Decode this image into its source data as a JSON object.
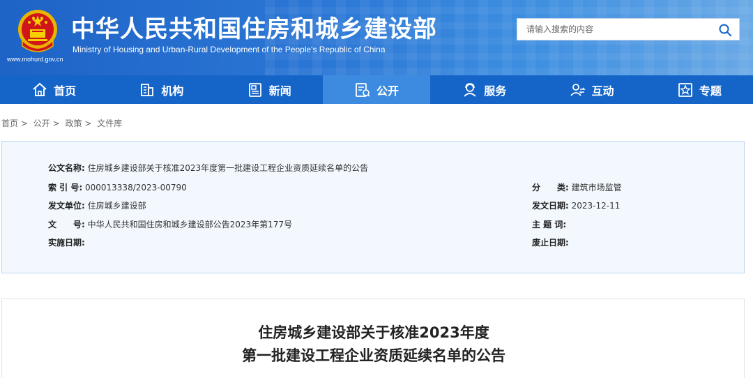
{
  "header": {
    "title_cn": "中华人民共和国住房和城乡建设部",
    "title_en": "Ministry of Housing and Urban-Rural Development of the People's Republic of China",
    "site_url": "www.mohurd.gov.cn",
    "emblem_icon": "national-emblem-icon",
    "search": {
      "placeholder": "请输入搜索的内容",
      "icon": "search-icon"
    }
  },
  "nav": {
    "items": [
      {
        "label": "首页",
        "icon": "home-icon"
      },
      {
        "label": "机构",
        "icon": "building-icon"
      },
      {
        "label": "新闻",
        "icon": "news-icon"
      },
      {
        "label": "公开",
        "icon": "disclosure-icon",
        "active": true
      },
      {
        "label": "服务",
        "icon": "service-icon"
      },
      {
        "label": "互动",
        "icon": "interaction-icon"
      },
      {
        "label": "专题",
        "icon": "topic-icon"
      }
    ]
  },
  "breadcrumb": {
    "items": [
      "首页",
      "公开",
      "政策",
      "文件库"
    ],
    "separator": ">"
  },
  "info": {
    "doc_name_label": "公文名称:",
    "doc_name": "住房城乡建设部关于核准2023年度第一批建设工程企业资质延续名单的公告",
    "index_label": "索 引 号:",
    "index": "000013338/2023-00790",
    "category_label": "分　　类:",
    "category": "建筑市场监管",
    "issuer_label": "发文单位:",
    "issuer": "住房城乡建设部",
    "issue_date_label": "发文日期:",
    "issue_date": "2023-12-11",
    "doc_no_label": "文　　号:",
    "doc_no": "中华人民共和国住房和城乡建设部公告2023年第177号",
    "keywords_label": "主 题 词:",
    "keywords": "",
    "effective_label": "实施日期:",
    "effective": "",
    "expiry_label": "废止日期:",
    "expiry": ""
  },
  "article": {
    "title_line1": "住房城乡建设部关于核准2023年度",
    "title_line2": "第一批建设工程企业资质延续名单的公告"
  },
  "colors": {
    "header_blue": "#1e63c6",
    "nav_blue": "#1565c8",
    "nav_active": "#3d8be0",
    "panel_bg": "#f2f8fe"
  }
}
